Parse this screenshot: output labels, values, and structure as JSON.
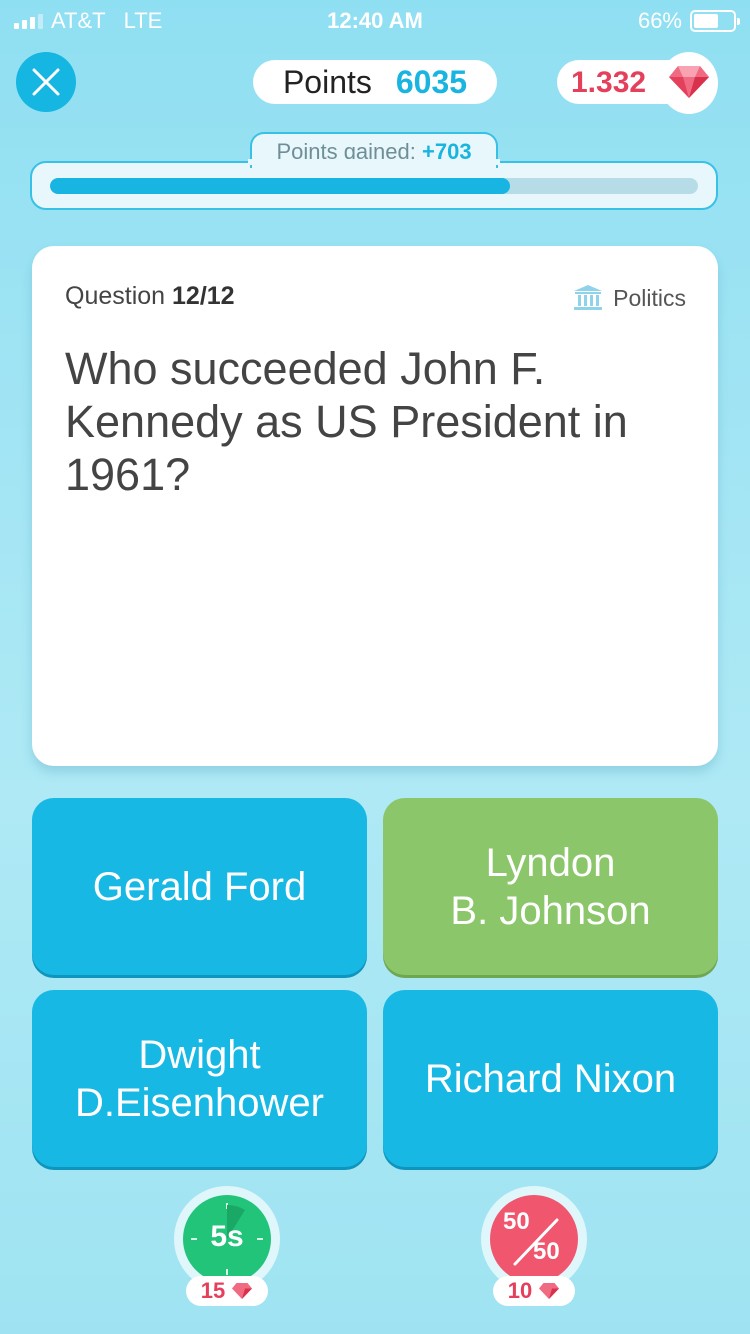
{
  "status_bar": {
    "carrier": "AT&T",
    "network": "LTE",
    "time": "12:40 AM",
    "battery_text": "66%",
    "battery_level": 0.66
  },
  "header": {
    "points_label": "Points",
    "points_value": "6035",
    "gems_value": "1.332"
  },
  "progress": {
    "gained_label": "Points gained:",
    "gained_value": "+703",
    "fraction": 0.71
  },
  "question": {
    "counter_label": "Question",
    "counter_value": "12/12",
    "category": "Politics",
    "text": "Who succeeded John F. Kennedy as US President in 1961?"
  },
  "answers": [
    {
      "label": "Gerald Ford",
      "state": "default"
    },
    {
      "label": "Lyndon\nB. Johnson",
      "state": "correct"
    },
    {
      "label": "Dwight\nD.Eisenhower",
      "state": "default"
    },
    {
      "label": "Richard Nixon",
      "state": "default"
    }
  ],
  "lifelines": {
    "time": {
      "label": "5s",
      "cost": "15"
    },
    "fifty": {
      "top": "50",
      "bottom": "50",
      "cost": "10"
    }
  },
  "colors": {
    "accent": "#18b8e4",
    "correct": "#8bc76a",
    "gem": "#e4405b"
  }
}
